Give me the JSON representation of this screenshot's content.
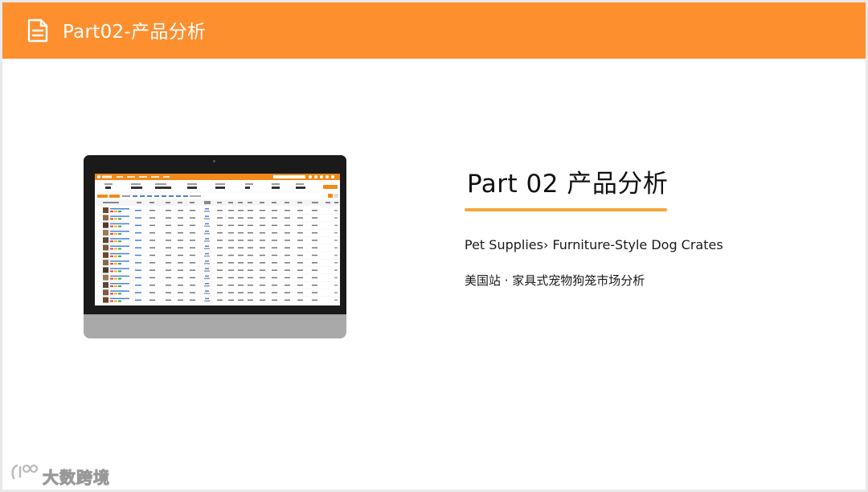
{
  "header": {
    "icon": "document-icon",
    "title": "Part02-产品分析"
  },
  "main": {
    "part_title": "Part 02  产品分析",
    "category_path": "Pet Supplies›  Furniture-Style Dog Crates",
    "subtitle": "美国站 · 家具式宠物狗笼市场分析",
    "underline_color": "#f5a63b"
  },
  "monitor": {
    "screen_app": "product-research-dashboard-screenshot"
  },
  "watermark": {
    "text": "大数跨境"
  },
  "colors": {
    "brand_orange": "#fd8f2f"
  }
}
